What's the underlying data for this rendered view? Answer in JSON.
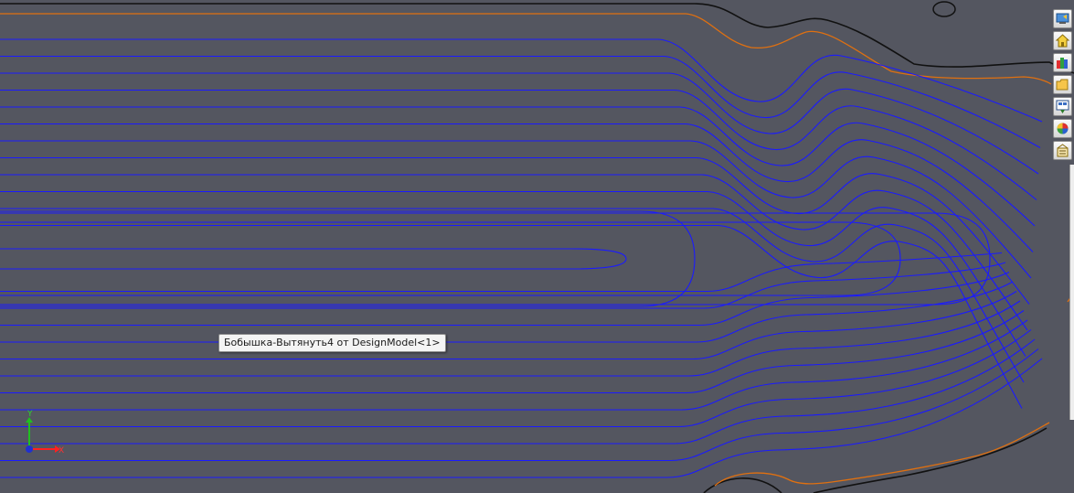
{
  "viewport": {
    "background": "#545660",
    "toolpath_color": "#1a1aff",
    "boundary_color": "#e07010",
    "edge_color": "#111111"
  },
  "tooltip": {
    "text": "Бобышка-Вытянуть4 от DesignModel<1>"
  },
  "triad": {
    "x_label": "X",
    "y_label": "Y"
  },
  "taskpane": {
    "buttons": [
      {
        "icon": "solidworks-resources-icon"
      },
      {
        "icon": "home-icon"
      },
      {
        "icon": "design-library-icon"
      },
      {
        "icon": "file-explorer-folder-icon"
      },
      {
        "icon": "view-palette-icon"
      },
      {
        "icon": "appearances-icon"
      },
      {
        "icon": "custom-properties-icon"
      }
    ]
  }
}
